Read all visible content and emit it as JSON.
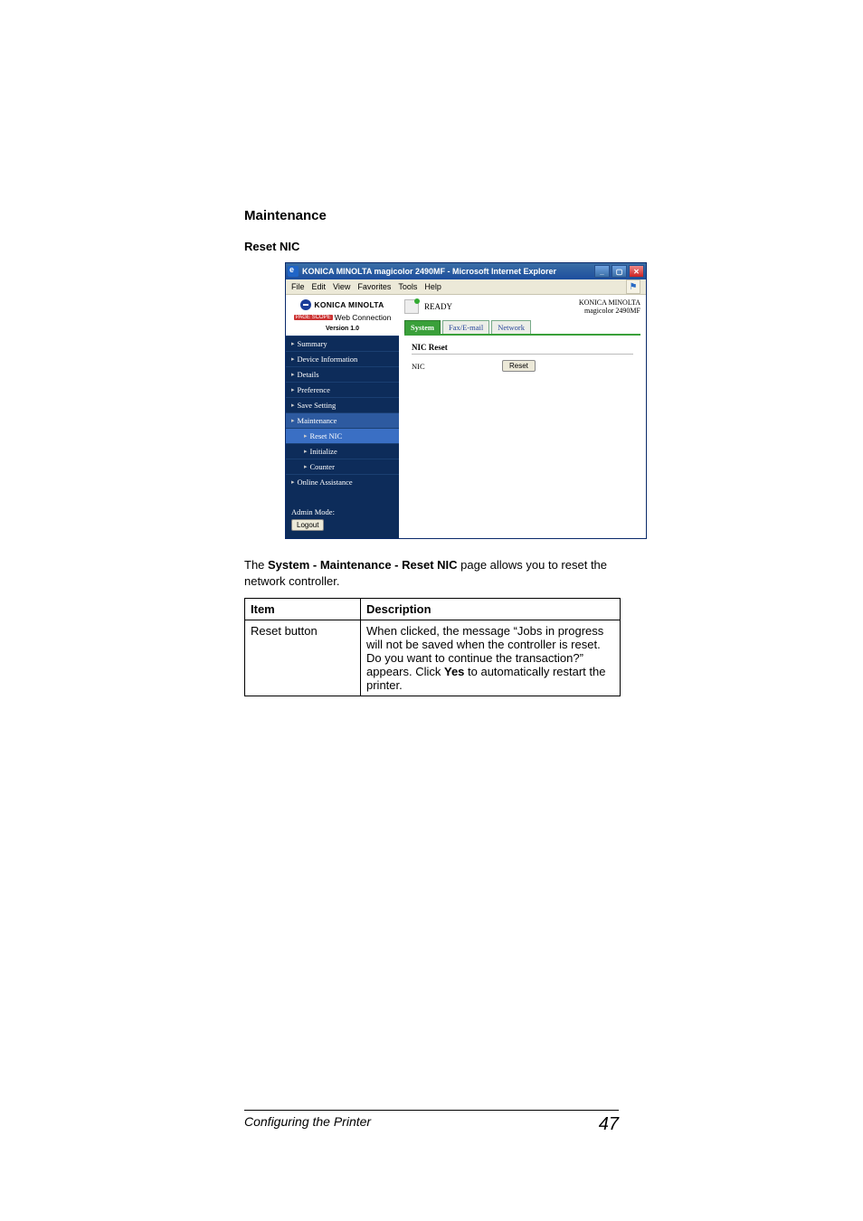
{
  "headings": {
    "h1": "Maintenance",
    "h2": "Reset NIC"
  },
  "ie": {
    "title": "KONICA MINOLTA magicolor 2490MF - Microsoft Internet Explorer",
    "menu": [
      "File",
      "Edit",
      "View",
      "Favorites",
      "Tools",
      "Help"
    ],
    "win_btns": {
      "min": "_",
      "max": "▢",
      "close": "✕"
    }
  },
  "sidebar": {
    "brand": "KONICA MINOLTA",
    "pagescope_prefix": "PAGE SCOPE",
    "pagescope": "Web Connection",
    "version": "Version 1.0",
    "items": [
      "Summary",
      "Device Information",
      "Details",
      "Preference",
      "Save Setting",
      "Maintenance",
      "Reset NIC",
      "Initialize",
      "Counter",
      "Online Assistance"
    ],
    "admin_mode": "Admin Mode:",
    "logout": "Logout"
  },
  "content": {
    "status": "READY",
    "brand": "KONICA MINOLTA",
    "model": "magicolor 2490MF",
    "tabs": [
      "System",
      "Fax/E-mail",
      "Network"
    ],
    "panel_title": "NIC Reset",
    "panel_label": "NIC",
    "reset_button": "Reset"
  },
  "paragraph": {
    "pre": "The ",
    "bold": "System - Maintenance - Reset NIC",
    "post": " page allows you to reset the net­work controller."
  },
  "table": {
    "head_item": "Item",
    "head_desc": "Description",
    "row_item": "Reset button",
    "row_desc_1": "When clicked, the message “Jobs in progress will not be saved when the controller is reset. Do you want to con­tinue the transaction?” appears. Click ",
    "row_desc_bold": "Yes",
    "row_desc_2": " to automati­cally restart the printer."
  },
  "footer": {
    "left": "Configuring the Printer",
    "page": "47"
  }
}
